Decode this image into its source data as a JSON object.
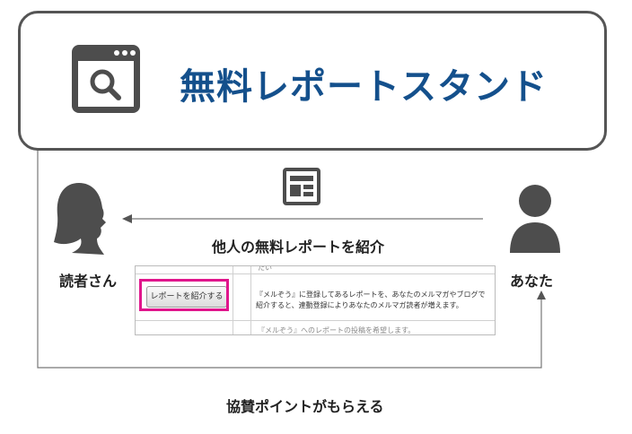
{
  "header": {
    "title": "無料レポートスタンド",
    "icon": "browser-search-icon",
    "title_color": "#14508c",
    "border_color": "#555555"
  },
  "actors": {
    "reader": {
      "label": "読者さん",
      "icon": "woman-silhouette-icon"
    },
    "you": {
      "label": "あなた",
      "icon": "person-silhouette-icon"
    }
  },
  "flows": {
    "introduce": {
      "label": "他人の無料レポートを紹介",
      "icon": "report-document-icon"
    },
    "points": {
      "label": "協賛ポイントがもらえる"
    }
  },
  "screenshot": {
    "button_label": "レポートを紹介する",
    "highlight_color": "#e0168c",
    "description": "『メルぞう』に登録してあるレポートを、あなたのメルマガやブログで紹介すると、連動登録によりあなたのメルマガ読者が増えます。",
    "top_cell_text": "たい",
    "bottom_cell_text": "『メルぞう』へのレポートの投稿を希望します。"
  }
}
